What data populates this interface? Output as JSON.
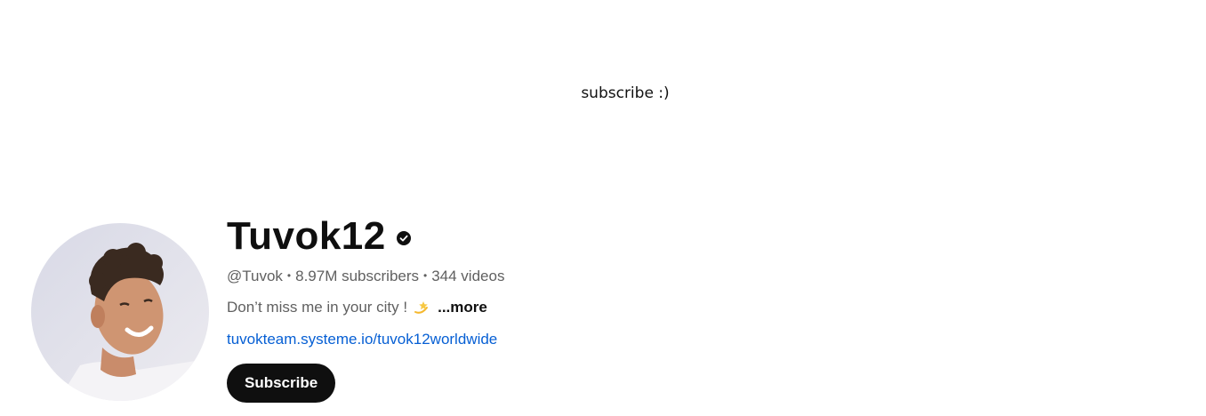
{
  "banner": {
    "text": "subscribe :)"
  },
  "channel": {
    "name": "Tuvok12",
    "handle": "@Tuvok",
    "subscribers": "8.97M subscribers",
    "videos": "344 videos",
    "separator": "•",
    "description": "Don’t miss me in your city !",
    "more_label": "...more",
    "link": "tuvokteam.systeme.io/tuvok12worldwide"
  },
  "actions": {
    "subscribe_label": "Subscribe"
  },
  "icons": {
    "verified": "verified-check-icon",
    "description_emoji": "dizzy-star-icon"
  },
  "colors": {
    "link": "#065fd4",
    "subscribe_bg": "#0f0f0f",
    "secondary_text": "#606060"
  }
}
